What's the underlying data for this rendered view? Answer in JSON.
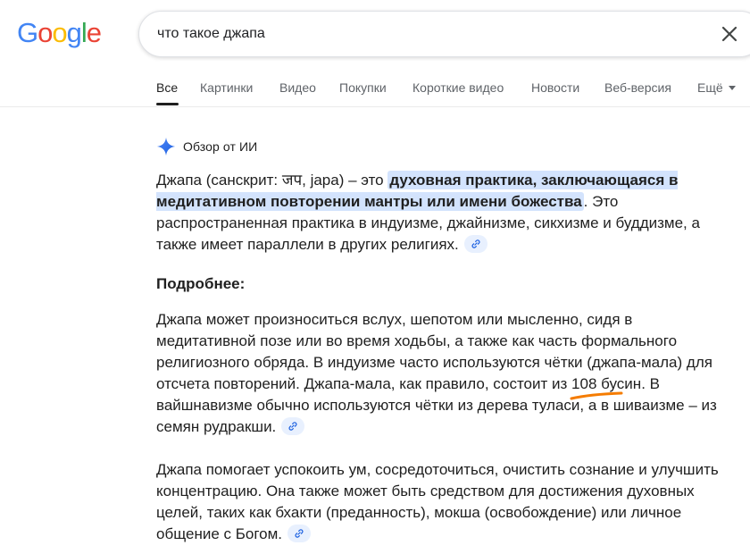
{
  "logo": {
    "letters": [
      {
        "ch": "G",
        "color": "#4285F4"
      },
      {
        "ch": "o",
        "color": "#EA4335"
      },
      {
        "ch": "o",
        "color": "#FBBC05"
      },
      {
        "ch": "g",
        "color": "#4285F4"
      },
      {
        "ch": "l",
        "color": "#34A853"
      },
      {
        "ch": "e",
        "color": "#EA4335"
      }
    ]
  },
  "search": {
    "value": "что такое джапа",
    "clear_icon": "close-icon"
  },
  "tabs": [
    {
      "label": "Все",
      "active": true
    },
    {
      "label": "Картинки"
    },
    {
      "label": "Видео"
    },
    {
      "label": "Покупки"
    },
    {
      "label": "Короткие видео"
    },
    {
      "label": "Новости"
    },
    {
      "label": "Веб-версия"
    },
    {
      "label": "Ещё"
    }
  ],
  "ai_overview": {
    "label": "Обзор от ИИ",
    "icon": "sparkle-icon",
    "intro_before": "Джапа (санскрит: जप, japa) – это ",
    "intro_highlight": "духовная практика, заключающаяся в медитативном повторении мантры или имени божества",
    "intro_after": ". Это распространенная практика в индуизме, джайнизме, сикхизме и буддизме, а также имеет параллели в других религиях.",
    "details_title": "Подробнее:",
    "details_before": "Джапа может произноситься вслух, шепотом или мысленно, сидя в медитативной позе или во время ходьбы, а также как часть формального религиозного обряда. В индуизме часто используются чётки (джапа-мала) для отсчета повторений. Джапа-мала, как правило, состоит из ",
    "details_marked": "108 бусин",
    "details_after": ". В вайшнавизме обычно используются чётки из дерева туласи, а в шиваизме – из семян рудракши.",
    "final": "Джапа помогает успокоить ум, сосредоточиться, очистить сознание и улучшить концентрацию. Она также может быть средством для достижения духовных целей, таких как бхакти (преданность), мокша (освобождение) или личное общение с Богом.",
    "annotation_color": "#F57C00",
    "chip_icon": "link-icon"
  }
}
